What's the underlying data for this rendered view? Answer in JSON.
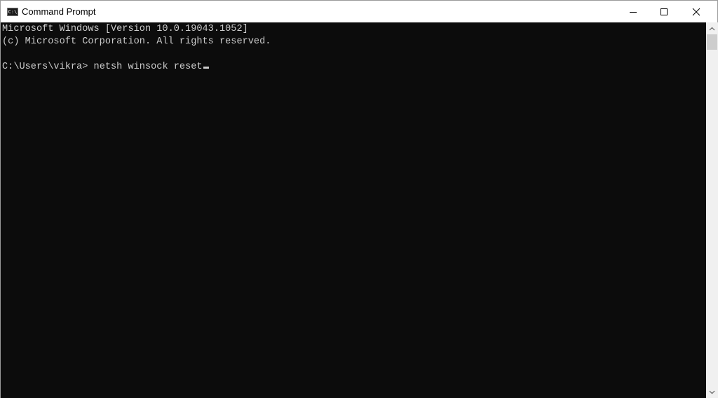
{
  "window": {
    "title": "Command Prompt",
    "app_icon": "cmd-icon",
    "app_icon_text": "C:\\",
    "controls": {
      "minimize": "minimize-icon",
      "maximize": "maximize-icon",
      "close": "close-icon"
    }
  },
  "console": {
    "lines": [
      "Microsoft Windows [Version 10.0.19043.1052]",
      "(c) Microsoft Corporation. All rights reserved.",
      "",
      "C:\\Users\\vikra> netsh winsock reset"
    ],
    "prompt": "C:\\Users\\vikra>",
    "command": "netsh winsock reset"
  },
  "scrollbar": {
    "up": "chevron-up-icon",
    "down": "chevron-down-icon"
  }
}
